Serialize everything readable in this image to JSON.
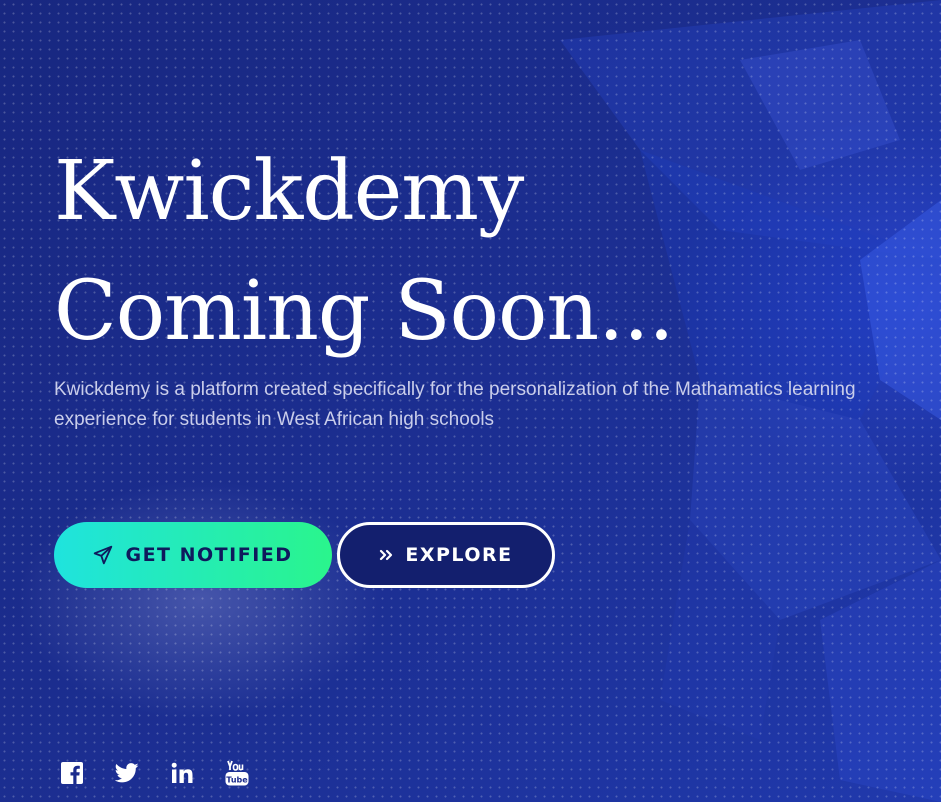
{
  "hero": {
    "title_line1": "Kwickdemy",
    "title_line2": "Coming Soon...",
    "description": "Kwickdemy is a platform created specifically for the personalization of the Mathamatics learning experience for students in West African high schools"
  },
  "buttons": {
    "notify": {
      "label": "GET NOTIFIED",
      "icon": "paper-plane-icon"
    },
    "explore": {
      "label": "EXPLORE",
      "icon": "double-chevron-right-icon"
    }
  },
  "social": [
    {
      "name": "facebook",
      "icon": "facebook-icon"
    },
    {
      "name": "twitter",
      "icon": "twitter-icon"
    },
    {
      "name": "linkedin",
      "icon": "linkedin-icon"
    },
    {
      "name": "youtube",
      "icon": "youtube-icon"
    }
  ],
  "colors": {
    "background": "#1a2a8c",
    "accent_gradient_start": "#1fe3de",
    "accent_gradient_end": "#2af58c",
    "text": "#ffffff",
    "muted_text": "#c9cdea"
  }
}
